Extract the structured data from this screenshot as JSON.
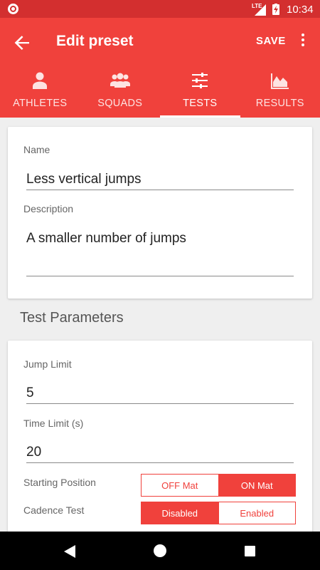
{
  "status_bar": {
    "network": "LTE",
    "time": "10:34"
  },
  "app_bar": {
    "title": "Edit preset",
    "save_label": "SAVE"
  },
  "tabs": [
    {
      "label": "ATHLETES",
      "icon": "person-icon",
      "active": false
    },
    {
      "label": "SQUADS",
      "icon": "group-icon",
      "active": false
    },
    {
      "label": "TESTS",
      "icon": "tune-icon",
      "active": true
    },
    {
      "label": "RESULTS",
      "icon": "area-chart-icon",
      "active": false
    }
  ],
  "preset": {
    "name_label": "Name",
    "name_value": "Less vertical jumps",
    "description_label": "Description",
    "description_value": "A smaller number of jumps"
  },
  "test_parameters": {
    "title": "Test Parameters",
    "jump_limit_label": "Jump Limit",
    "jump_limit_value": "5",
    "time_limit_label": "Time Limit (s)",
    "time_limit_value": "20",
    "starting_position": {
      "label": "Starting Position",
      "options": [
        "OFF Mat",
        "ON Mat"
      ],
      "selected": "ON Mat"
    },
    "cadence_test": {
      "label": "Cadence Test",
      "options": [
        "Disabled",
        "Enabled"
      ],
      "selected": "Disabled"
    }
  },
  "colors": {
    "primary": "#f0413c",
    "status_bar": "#d32f2f"
  }
}
